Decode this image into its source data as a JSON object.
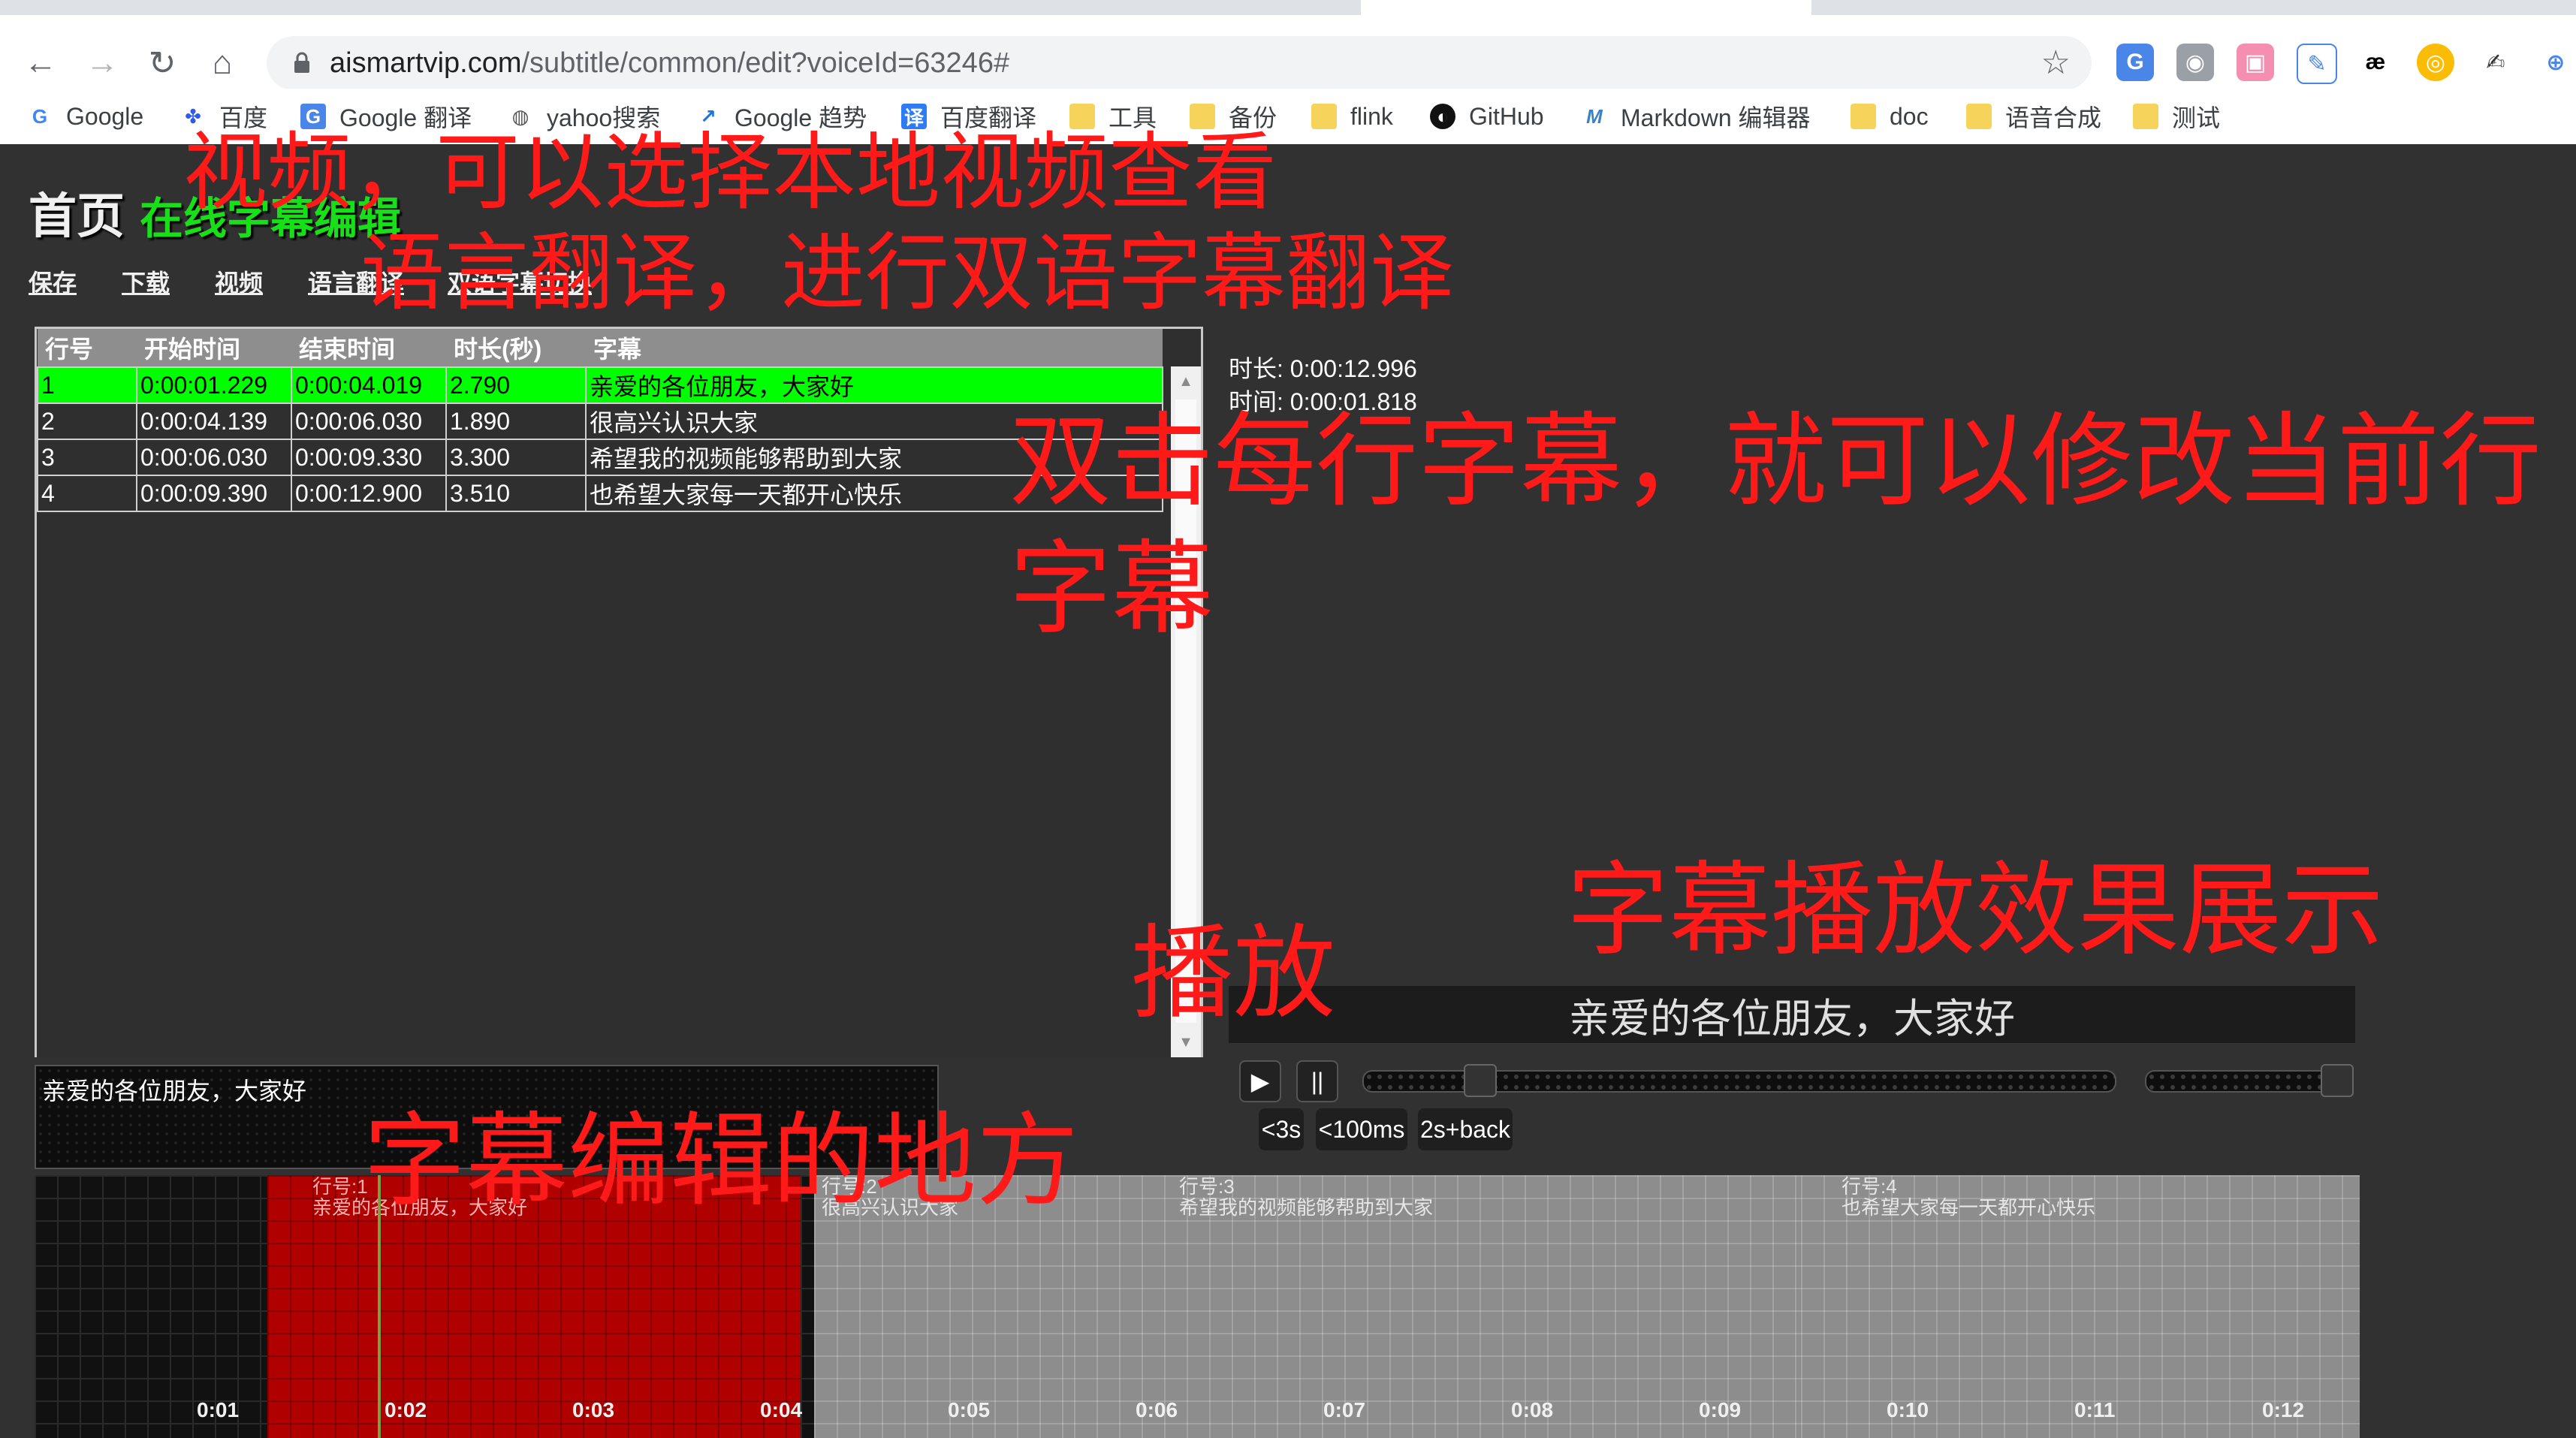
{
  "browser": {
    "url_host": "aismartvip.com",
    "url_path": "/subtitle/common/edit?voiceId=63246#",
    "bookmarks": [
      {
        "label": "Google",
        "icon": "google-icon"
      },
      {
        "label": "百度",
        "icon": "baidu-icon"
      },
      {
        "label": "Google 翻译",
        "icon": "google-translate-icon"
      },
      {
        "label": "yahoo搜索",
        "icon": "globe-icon"
      },
      {
        "label": "Google 趋势",
        "icon": "trends-icon"
      },
      {
        "label": "百度翻译",
        "icon": "baidu-translate-icon"
      },
      {
        "label": "工具",
        "icon": "folder-icon"
      },
      {
        "label": "备份",
        "icon": "folder-icon"
      },
      {
        "label": "flink",
        "icon": "folder-icon"
      },
      {
        "label": "GitHub",
        "icon": "github-icon"
      },
      {
        "label": "Markdown 编辑器",
        "icon": "markdown-icon"
      },
      {
        "label": "doc",
        "icon": "folder-icon"
      },
      {
        "label": "语音合成",
        "icon": "folder-icon"
      },
      {
        "label": "测试",
        "icon": "folder-icon"
      }
    ]
  },
  "header": {
    "title": "首页",
    "subtitle": "在线字幕编辑"
  },
  "menu": {
    "save": "保存",
    "download": "下载",
    "video": "视频",
    "translate": "语言翻译",
    "bilingual": "双语字幕切换"
  },
  "table": {
    "columns": [
      "行号",
      "开始时间",
      "结束时间",
      "时长(秒)",
      "字幕"
    ],
    "rows": [
      [
        "1",
        "0:00:01.229",
        "0:00:04.019",
        "2.790",
        "亲爱的各位朋友，大家好"
      ],
      [
        "2",
        "0:00:04.139",
        "0:00:06.030",
        "1.890",
        "很高兴认识大家"
      ],
      [
        "3",
        "0:00:06.030",
        "0:00:09.330",
        "3.300",
        "希望我的视频能够帮助到大家"
      ],
      [
        "4",
        "0:00:09.390",
        "0:00:12.900",
        "3.510",
        "也希望大家每一天都开心快乐"
      ]
    ]
  },
  "video_info": {
    "duration": "时长: 0:00:12.996",
    "time": "时间: 0:00:01.818"
  },
  "player": {
    "subtitle": "亲爱的各位朋友，大家好",
    "play": "▶",
    "pause": "||",
    "back3s": "<3s",
    "back100ms": "<100ms",
    "loop": "2s+back",
    "progress": 0.14,
    "volume": 1.0
  },
  "editor": {
    "text": "亲爱的各位朋友，大家好"
  },
  "timeline": {
    "segments": [
      {
        "label": "行号:1",
        "text": "亲爱的各位朋友，大家好",
        "style": "red"
      },
      {
        "label": "行号:2",
        "text": "很高兴认识大家",
        "style": "grey"
      },
      {
        "label": "行号:3",
        "text": "希望我的视频能够帮助到大家",
        "style": "grey"
      },
      {
        "label": "行号:4",
        "text": "也希望大家每一天都开心快乐",
        "style": "grey"
      }
    ],
    "ticks": [
      "0:01",
      "0:02",
      "0:03",
      "0:04",
      "0:05",
      "0:06",
      "0:07",
      "0:08",
      "0:09",
      "0:10",
      "0:11",
      "0:12"
    ]
  },
  "annotations": {
    "video_note": "视频，可以选择本地视频查看",
    "translate_note": "语言翻译，进行双语字幕翻译",
    "dblclick_note_line1": "双击每行字幕，就可以修改当前行",
    "dblclick_note_line2": "字幕",
    "preview_note": "字幕播放效果展示",
    "play_note": "播放",
    "edit_note": "字幕编辑的地方"
  },
  "colors": {
    "selected_row": "#00ff00",
    "brand_sub": "#18e018",
    "annotation": "#ff1a1a",
    "active_segment": "#b00000"
  }
}
